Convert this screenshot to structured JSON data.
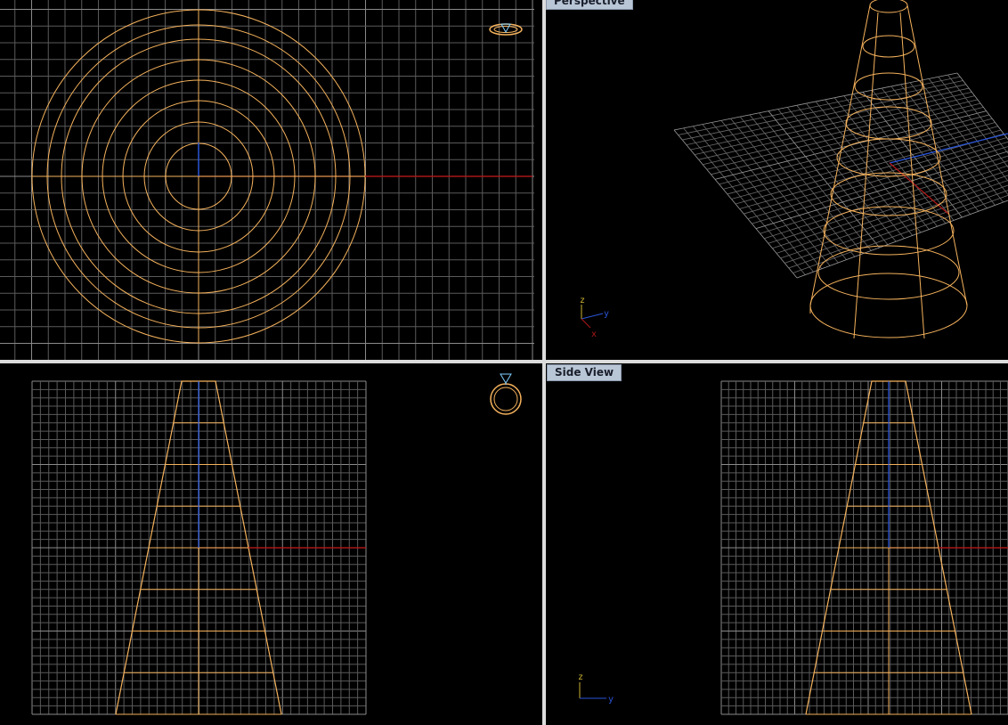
{
  "viewports": {
    "top": {
      "label": ""
    },
    "perspective": {
      "label": "Perspective"
    },
    "front": {
      "label": ""
    },
    "side": {
      "label": "Side View"
    }
  },
  "axis_labels": {
    "x": "x",
    "y": "y",
    "z": "z"
  },
  "colors": {
    "background": "#000000",
    "grid": "#5a5a5a",
    "grid_major": "#8a8a8a",
    "geometry": "#f5b25c",
    "x_axis": "#b01818",
    "y_axis": "#2a55d8",
    "z_axis": "#c8b030",
    "label_bg": "#b9c6d6",
    "separator": "#dcdcdc"
  },
  "icons": {
    "top": "ring-navigation-icon",
    "front": "ring-navigation-icon"
  }
}
